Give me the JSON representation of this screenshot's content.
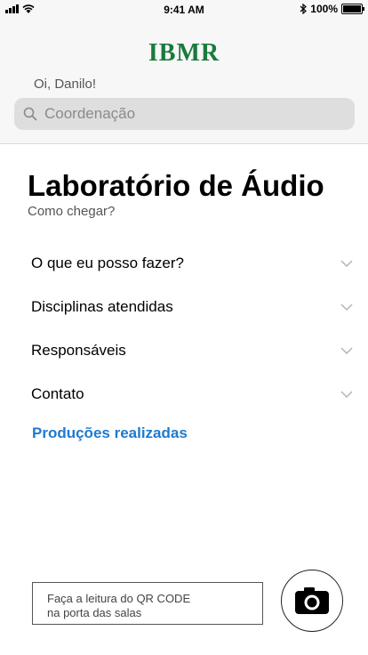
{
  "status": {
    "time": "9:41 AM",
    "battery": "100%"
  },
  "header": {
    "logo": "IBMR",
    "logo_color": "#1a7a3c",
    "greeting": "Oi, Danilo!",
    "search_placeholder": "Coordenação"
  },
  "main": {
    "title": "Laboratório de Áudio",
    "subtitle": "Como chegar?",
    "sections": [
      {
        "label": "O que eu posso fazer?"
      },
      {
        "label": "Disciplinas atendidas"
      },
      {
        "label": "Responsáveis"
      },
      {
        "label": "Contato"
      }
    ],
    "link": "Produções realizadas",
    "link_color": "#1e7ad0"
  },
  "footer": {
    "qr_line1": "Faça a leitura do QR CODE",
    "qr_line2": "na porta das salas",
    "camera_icon": "camera-icon"
  }
}
